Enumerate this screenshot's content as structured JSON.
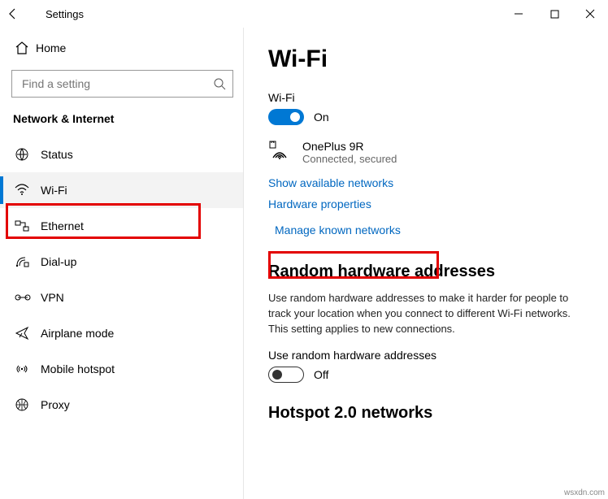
{
  "titlebar": {
    "title": "Settings"
  },
  "sidebar": {
    "home": "Home",
    "search_placeholder": "Find a setting",
    "category": "Network & Internet",
    "items": [
      {
        "label": "Status"
      },
      {
        "label": "Wi-Fi"
      },
      {
        "label": "Ethernet"
      },
      {
        "label": "Dial-up"
      },
      {
        "label": "VPN"
      },
      {
        "label": "Airplane mode"
      },
      {
        "label": "Mobile hotspot"
      },
      {
        "label": "Proxy"
      }
    ]
  },
  "content": {
    "title": "Wi-Fi",
    "wifi_label": "Wi-Fi",
    "wifi_state": "On",
    "network_name": "OnePlus 9R",
    "network_status": "Connected, secured",
    "link_available": "Show available networks",
    "link_hwprops": "Hardware properties",
    "link_manage": "Manage known networks",
    "rha_heading": "Random hardware addresses",
    "rha_text": "Use random hardware addresses to make it harder for people to track your location when you connect to different Wi-Fi networks. This setting applies to new connections.",
    "rha_sublabel": "Use random hardware addresses",
    "rha_state": "Off",
    "hotspot_heading": "Hotspot 2.0 networks"
  },
  "watermark": "wsxdn.com"
}
